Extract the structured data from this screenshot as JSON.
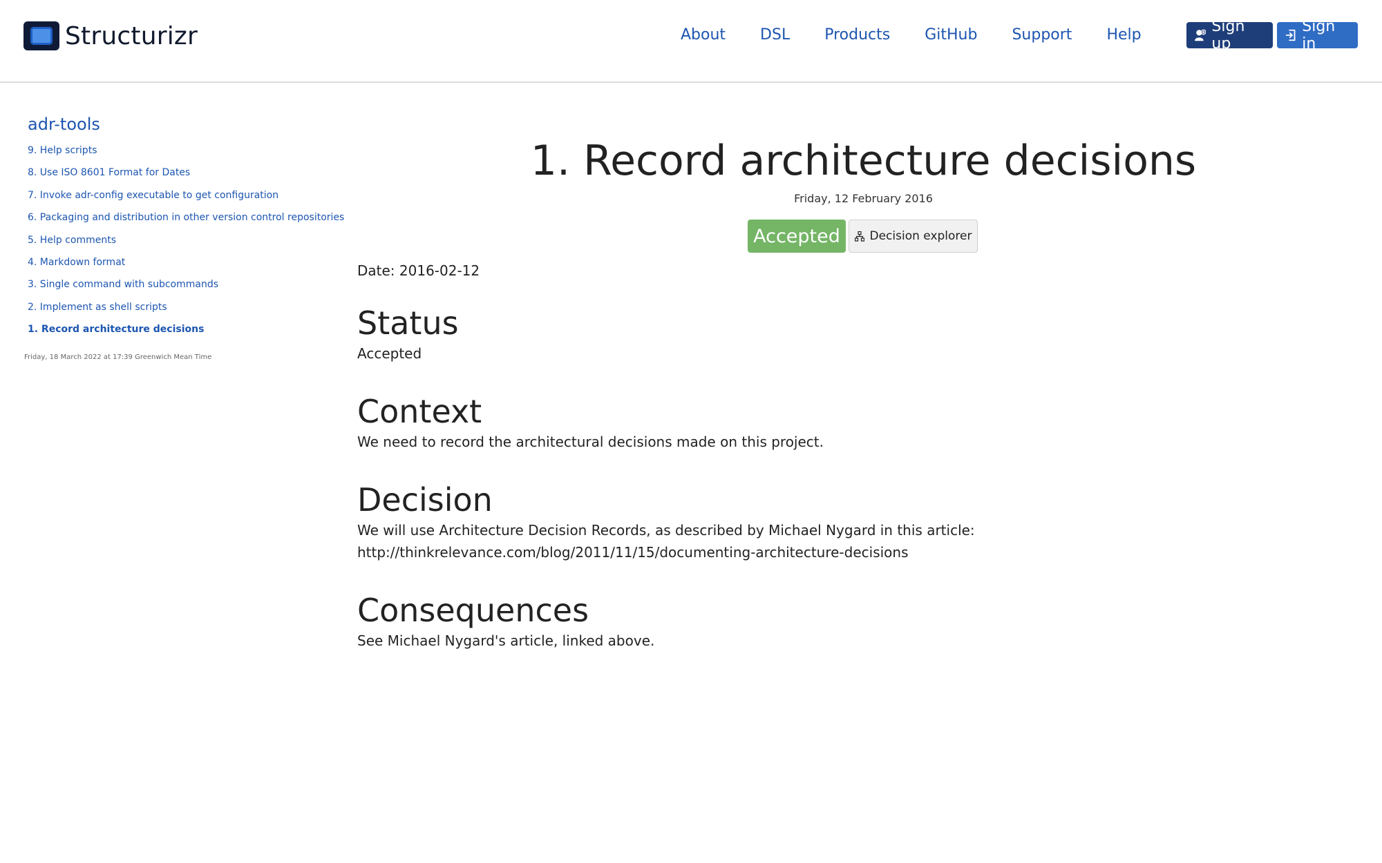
{
  "header": {
    "brand_name": "Structurizr",
    "nav": [
      "About",
      "DSL",
      "Products",
      "GitHub",
      "Support",
      "Help"
    ],
    "signup_label": "Sign up",
    "signin_label": "Sign in"
  },
  "sidebar": {
    "title": "adr-tools",
    "items": [
      {
        "label": "9. Help scripts"
      },
      {
        "label": "8. Use ISO 8601 Format for Dates"
      },
      {
        "label": "7. Invoke adr-config executable to get configuration"
      },
      {
        "label": "6. Packaging and distribution in other version control repositories"
      },
      {
        "label": "5. Help comments"
      },
      {
        "label": "4. Markdown format"
      },
      {
        "label": "3. Single command with subcommands"
      },
      {
        "label": "2. Implement as shell scripts"
      },
      {
        "label": "1. Record architecture decisions",
        "active": true
      }
    ],
    "timestamp": "Friday, 18 March 2022 at 17:39 Greenwich Mean Time"
  },
  "main": {
    "title": "1. Record architecture decisions",
    "date": "Friday, 12 February 2016",
    "status_badge": "Accepted",
    "explorer_label": "Decision explorer",
    "date_line": "Date: 2016-02-12",
    "sections": [
      {
        "heading": "Status",
        "text": "Accepted"
      },
      {
        "heading": "Context",
        "text": "We need to record the architectural decisions made on this project."
      },
      {
        "heading": "Decision",
        "text": "We will use Architecture Decision Records, as described by Michael Nygard in this article: http://thinkrelevance.com/blog/2011/11/15/documenting-architecture-decisions"
      },
      {
        "heading": "Consequences",
        "text": "See Michael Nygard's article, linked above."
      }
    ]
  },
  "colors": {
    "link": "#1c55b0",
    "signup_bg": "#1e3e7a",
    "signin_bg": "#2f6cc4",
    "accepted_bg": "#74b566"
  },
  "icons": {
    "signup": "user-plus-icon",
    "signin": "sign-in-icon",
    "explorer": "sitemap-icon"
  }
}
